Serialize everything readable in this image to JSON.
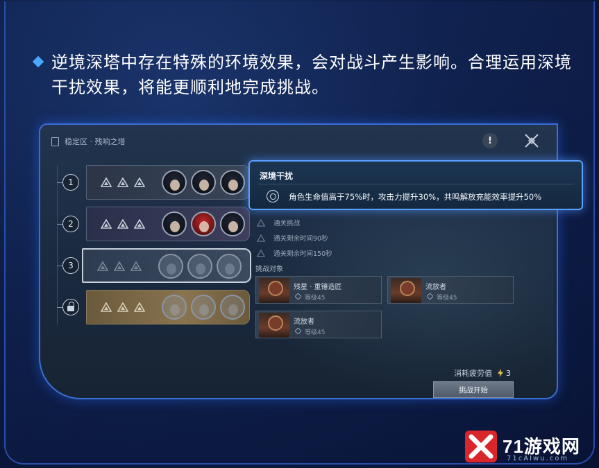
{
  "intro": {
    "text": "逆境深塔中存在特殊的环境效果，会对战斗产生影响。合理运用深境干扰效果，将能更顺利地完成挑战。"
  },
  "screen": {
    "breadcrumb": "稳定区 · 残响之塔",
    "info_symbol": "!",
    "floors": [
      {
        "label": "1",
        "selected": false,
        "locked": false
      },
      {
        "label": "2",
        "selected": false,
        "locked": false
      },
      {
        "label": "3",
        "selected": true,
        "locked": false
      },
      {
        "label": "",
        "selected": false,
        "locked": true
      }
    ],
    "tooltip": {
      "title": "深境干扰",
      "effect": "角色生命值高于75%时，攻击力提升30%，共鸣解放充能效率提升50%"
    },
    "objectives": [
      "通关挑战",
      "通关剩余时间90秒",
      "通关剩余时间150秒"
    ],
    "challenge_heading": "挑战对象",
    "enemies": [
      {
        "name": "残星 · 重锤造匠",
        "level": "等级45"
      },
      {
        "name": "流放者",
        "level": "等级45"
      },
      {
        "name": "流放者",
        "level": "等级45"
      }
    ],
    "stamina": {
      "label": "消耗疲劳值",
      "value": "3"
    },
    "start_button": "挑战开始"
  },
  "watermark": {
    "name": "71游戏网",
    "url": "71cAIwu.com"
  },
  "colors": {
    "accent": "#4aa8ff",
    "tooltip_border": "#5aa0ff",
    "frame": "#3b6fd8"
  }
}
